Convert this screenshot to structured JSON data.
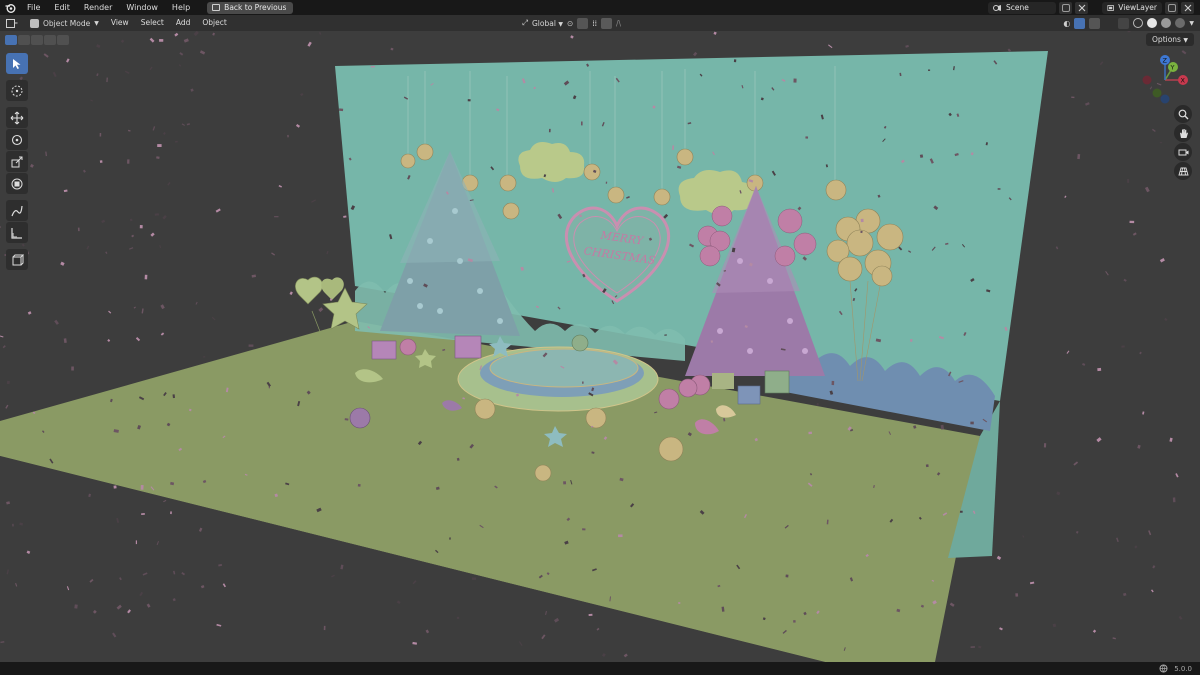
{
  "topbar": {
    "menus": [
      "File",
      "Edit",
      "Render",
      "Window",
      "Help"
    ],
    "back_button": "Back to Previous",
    "scene": "Scene",
    "view_layer": "ViewLayer"
  },
  "header": {
    "mode": "Object Mode",
    "menus": [
      "View",
      "Select",
      "Add",
      "Object"
    ],
    "orientation": "Global"
  },
  "viewport": {
    "options_label": "Options",
    "banner_text": [
      "MERRY",
      "CHRISTMAS"
    ],
    "gizmo_axes": [
      "X",
      "Y",
      "Z"
    ]
  },
  "toolbar": {
    "tools": [
      "select-box",
      "cursor",
      "move",
      "rotate",
      "scale",
      "transform",
      "annotate",
      "measure",
      "add-cube"
    ]
  },
  "statusbar": {
    "version": "5.0.0"
  },
  "colors": {
    "accent": "#4772b3",
    "backdrop": "#76b6a9",
    "floor": "#8a9a64",
    "tree_left": "#7ea0a8",
    "tree_right": "#9c7aa8",
    "gold": "#c9b681"
  }
}
